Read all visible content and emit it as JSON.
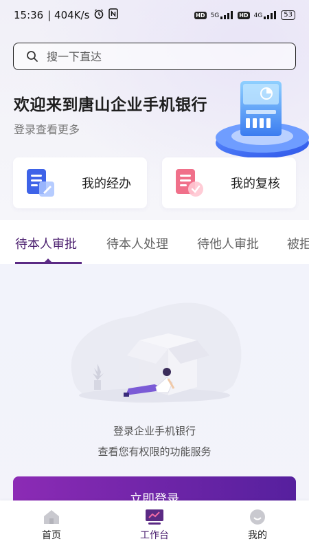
{
  "status_bar": {
    "time": "15:36",
    "speed": "| 404K/s",
    "net1": "5G",
    "net2": "4G",
    "hd": "HD",
    "battery": "53"
  },
  "search": {
    "placeholder": "搜一下直达"
  },
  "hero": {
    "title": "欢迎来到唐山企业手机银行",
    "subtitle": "登录查看更多"
  },
  "quick_cards": [
    {
      "label": "我的经办",
      "icon": "document-edit-icon"
    },
    {
      "label": "我的复核",
      "icon": "document-check-icon"
    }
  ],
  "tabs": [
    {
      "label": "待本人审批",
      "active": true
    },
    {
      "label": "待本人处理",
      "active": false
    },
    {
      "label": "待他人审批",
      "active": false
    },
    {
      "label": "被拒",
      "active": false
    }
  ],
  "empty_state": {
    "line1": "登录企业手机银行",
    "line2": "查看您有权限的功能服务"
  },
  "login_button": "立即登录",
  "bottom_nav": [
    {
      "label": "首页",
      "icon": "home-icon",
      "active": false
    },
    {
      "label": "工作台",
      "icon": "workbench-icon",
      "active": true
    },
    {
      "label": "我的",
      "icon": "profile-icon",
      "active": false
    }
  ],
  "colors": {
    "accent": "#5b2a84",
    "button_start": "#8c2bb5",
    "button_end": "#56209e"
  }
}
